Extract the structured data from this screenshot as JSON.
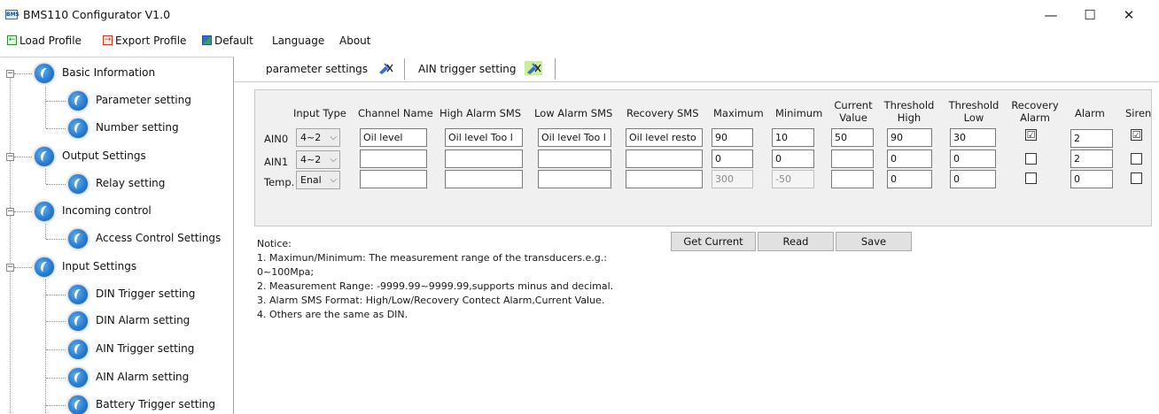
{
  "window": {
    "title": "BMS110 Configurator V1.0",
    "icon_text": "BMS",
    "minimize": "—",
    "maximize": "☐",
    "close": "✕"
  },
  "menu": {
    "load_profile": "Load Profile",
    "export_profile": "Export Profile",
    "default": "Default",
    "language": "Language",
    "about": "About"
  },
  "tree": {
    "groups": [
      {
        "label": "Basic Information",
        "toggle": "−",
        "children": [
          "Parameter setting",
          "Number setting"
        ]
      },
      {
        "label": "Output Settings",
        "toggle": "−",
        "children": [
          "Relay setting"
        ]
      },
      {
        "label": "Incoming control",
        "toggle": "−",
        "children": [
          "Access Control Settings"
        ]
      },
      {
        "label": "Input Settings",
        "toggle": "−",
        "children": [
          "DIN Trigger setting",
          "DIN Alarm setting",
          "AIN Trigger setting",
          "AIN Alarm setting",
          "Battery Trigger setting"
        ]
      }
    ]
  },
  "tabs": [
    {
      "label": "parameter settings",
      "active": false
    },
    {
      "label": "AIN trigger setting",
      "active": true
    }
  ],
  "table": {
    "headers": {
      "input_type": "Input Type",
      "channel_name": "Channel Name",
      "high_alarm_sms": "High Alarm SMS",
      "low_alarm_sms": "Low Alarm SMS",
      "recovery_sms": "Recovery SMS",
      "maximum": "Maximum",
      "minimum": "Minimum",
      "current_value_1": "Current",
      "current_value_2": "Value",
      "threshold_high_1": "Threshold",
      "threshold_high_2": "High",
      "threshold_low_1": "Threshold",
      "threshold_low_2": "Low",
      "recovery_alarm_1": "Recovery",
      "recovery_alarm_2": "Alarm",
      "alarm": "Alarm",
      "siren": "Siren"
    },
    "rows": [
      {
        "label": "AIN0",
        "input_type": "4~2",
        "channel_name": "Oil level",
        "high_alarm_sms": "Oil level Too l",
        "low_alarm_sms": "Oil level Too l",
        "recovery_sms": "Oil level resto",
        "maximum": "90",
        "minimum": "10",
        "current_value": "50",
        "threshold_high": "90",
        "threshold_low": "30",
        "recovery_alarm": "☑",
        "alarm": "2",
        "siren": "☑"
      },
      {
        "label": "AIN1",
        "input_type": "4~2",
        "channel_name": "",
        "high_alarm_sms": "",
        "low_alarm_sms": "",
        "recovery_sms": "",
        "maximum": "0",
        "minimum": "0",
        "current_value": "",
        "threshold_high": "0",
        "threshold_low": "0",
        "recovery_alarm": "",
        "alarm": "2",
        "siren": ""
      },
      {
        "label": "Temp.",
        "input_type": "Enal",
        "channel_name": "",
        "high_alarm_sms": "",
        "low_alarm_sms": "",
        "recovery_sms": "",
        "maximum": "300",
        "minimum": "-50",
        "current_value": "",
        "threshold_high": "0",
        "threshold_low": "0",
        "recovery_alarm": "",
        "alarm": "0",
        "siren": ""
      }
    ]
  },
  "buttons": {
    "get_current": "Get Current",
    "read": "Read",
    "save": "Save"
  },
  "notice": {
    "title": "Notice:",
    "lines": [
      "1. Maximun/Minimum: The measurement range of the transducers.e.g.:",
      "0~100Mpa;",
      "2. Measurement Range: -9999.99~9999.99,supports minus and decimal.",
      "3. Alarm SMS Format: High/Low/Recovery Contect Alarm,Current Value.",
      "4. Others are the same as DIN."
    ]
  }
}
